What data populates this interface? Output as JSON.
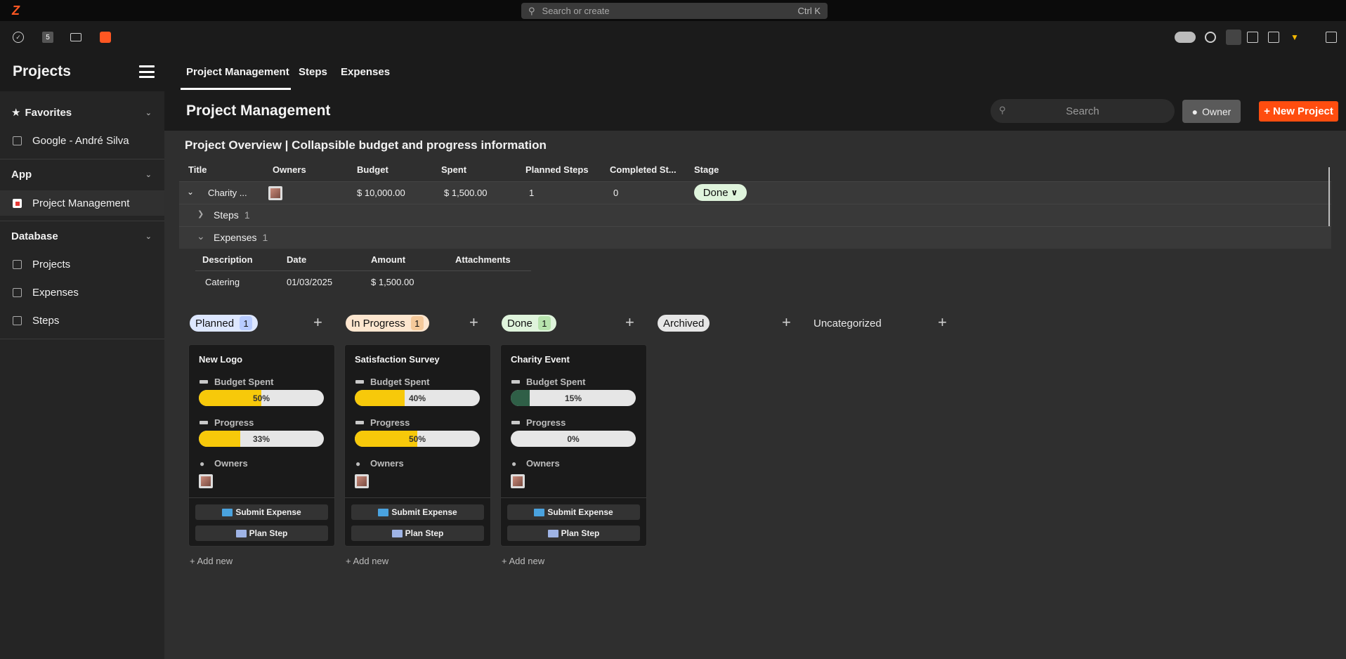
{
  "topbar": {
    "search_placeholder": "Search or create",
    "shortcut": "Ctrl K"
  },
  "toolbar": {
    "left_badge": "5"
  },
  "sidebar": {
    "title": "Projects",
    "favorites": {
      "label": "Favorites",
      "items": [
        {
          "label": "Google - André Silva"
        }
      ]
    },
    "app": {
      "label": "App",
      "items": [
        {
          "label": "Project Management"
        }
      ]
    },
    "database": {
      "label": "Database",
      "items": [
        {
          "label": "Projects"
        },
        {
          "label": "Expenses"
        },
        {
          "label": "Steps"
        }
      ]
    }
  },
  "header": {
    "tabs": [
      {
        "label": "Project Management"
      },
      {
        "label": "Steps"
      },
      {
        "label": "Expenses"
      }
    ],
    "page_title": "Project Management",
    "search_placeholder": "Search",
    "owner_button": "Owner",
    "new_project_button": "+ New Project"
  },
  "overview": {
    "title": "Project Overview | Collapsible budget and progress information",
    "columns": [
      "Title",
      "Owners",
      "Budget",
      "Spent",
      "Planned Steps",
      "Completed St...",
      "Stage"
    ],
    "row": {
      "title": "Charity ...",
      "budget": "$ 10,000.00",
      "spent": "$ 1,500.00",
      "planned_steps": "1",
      "completed_steps": "0",
      "stage": "Done"
    },
    "steps": {
      "label": "Steps",
      "count": "1"
    },
    "expenses": {
      "label": "Expenses",
      "count": "1"
    },
    "expense_columns": [
      "Description",
      "Date",
      "Amount",
      "Attachments"
    ],
    "expense_row": {
      "description": "Catering",
      "date": "01/03/2025",
      "amount": "$ 1,500.00"
    }
  },
  "board": {
    "columns": [
      {
        "label": "Planned",
        "count": "1",
        "color": "#dde7ff",
        "count_bg": "#b8ccff"
      },
      {
        "label": "In Progress",
        "count": "1",
        "color": "#fde6cf",
        "count_bg": "#f5c99a"
      },
      {
        "label": "Done",
        "count": "1",
        "color": "#dff4dc",
        "count_bg": "#b7e3ad"
      },
      {
        "label": "Archived",
        "count": "",
        "color": "#e6e6e6",
        "count_bg": ""
      },
      {
        "label": "Uncategorized",
        "count": "",
        "color": "",
        "count_bg": ""
      }
    ],
    "card_labels": {
      "budget_spent": "Budget Spent",
      "progress": "Progress",
      "owners": "Owners",
      "submit_expense": "Submit Expense",
      "plan_step": "Plan Step"
    },
    "cards": [
      {
        "title": "New Logo",
        "budget_spent": "50%",
        "budget_fraction": 0.5,
        "budget_color": "#f7c90a",
        "progress": "33%",
        "progress_fraction": 0.33,
        "progress_color": "#f7c90a"
      },
      {
        "title": "Satisfaction Survey",
        "budget_spent": "40%",
        "budget_fraction": 0.4,
        "budget_color": "#f7c90a",
        "progress": "50%",
        "progress_fraction": 0.5,
        "progress_color": "#f7c90a"
      },
      {
        "title": "Charity Event",
        "budget_spent": "15%",
        "budget_fraction": 0.15,
        "budget_color": "#2f5f47",
        "progress": "0%",
        "progress_fraction": 0,
        "progress_color": "#f7c90a"
      }
    ],
    "add_new": "Add new"
  }
}
